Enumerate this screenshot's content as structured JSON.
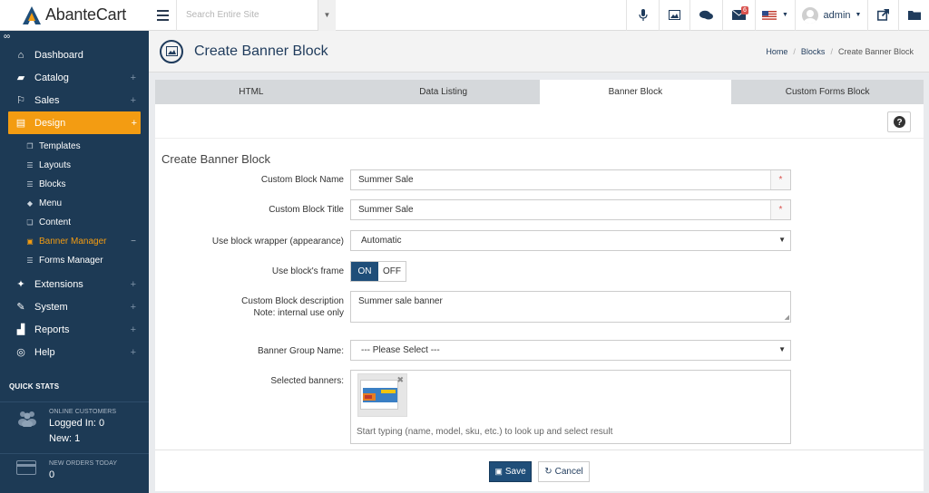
{
  "app": {
    "name": "AbanteCart"
  },
  "search": {
    "placeholder": "Search Entire Site"
  },
  "topbar": {
    "messages_badge": "6",
    "user": "admin"
  },
  "sidebar": {
    "items": [
      {
        "label": "Dashboard",
        "icon": "home-icon",
        "expandable": false
      },
      {
        "label": "Catalog",
        "icon": "folder-open-icon",
        "expandable": true
      },
      {
        "label": "Sales",
        "icon": "flag-icon",
        "expandable": true
      },
      {
        "label": "Design",
        "icon": "file-icon",
        "expandable": true,
        "active": true
      }
    ],
    "design_children": [
      {
        "label": "Templates",
        "icon": "templates-icon"
      },
      {
        "label": "Layouts",
        "icon": "list-icon"
      },
      {
        "label": "Blocks",
        "icon": "list-icon"
      },
      {
        "label": "Menu",
        "icon": "tag-icon"
      },
      {
        "label": "Content",
        "icon": "copy-icon"
      },
      {
        "label": "Banner Manager",
        "icon": "image-icon",
        "current": true
      },
      {
        "label": "Forms Manager",
        "icon": "list-icon"
      }
    ],
    "items_after": [
      {
        "label": "Extensions",
        "icon": "puzzle-icon"
      },
      {
        "label": "System",
        "icon": "wrench-icon"
      },
      {
        "label": "Reports",
        "icon": "bar-chart-icon"
      },
      {
        "label": "Help",
        "icon": "life-ring-icon"
      }
    ],
    "quick_stats": {
      "title": "QUICK STATS",
      "online_label": "ONLINE CUSTOMERS",
      "logged_in": "Logged In: 0",
      "new": "New: 1",
      "orders_label": "NEW ORDERS TODAY",
      "orders_value": "0"
    }
  },
  "header": {
    "title": "Create Banner Block",
    "breadcrumb": [
      "Home",
      "Blocks",
      "Create Banner Block"
    ]
  },
  "tabs": [
    "HTML",
    "Data Listing",
    "Banner Block",
    "Custom Forms Block"
  ],
  "active_tab_index": 2,
  "form": {
    "title": "Create Banner Block",
    "name_label": "Custom Block Name",
    "name_value": "Summer Sale",
    "title_label": "Custom Block Title",
    "title_value": "Summer Sale",
    "wrapper_label": "Use block wrapper (appearance)",
    "wrapper_value": "Automatic",
    "frame_label": "Use block's frame",
    "frame_on": "ON",
    "frame_off": "OFF",
    "desc_label_1": "Custom Block description",
    "desc_label_2": "Note: internal use only",
    "desc_value": "Summer sale banner",
    "group_label": "Banner Group Name:",
    "group_value": "--- Please Select ---",
    "selected_label": "Selected banners:",
    "selected_placeholder": "Start typing (name, model, sku, etc.) to look up and select result",
    "required_mark": "*"
  },
  "buttons": {
    "save": "Save",
    "cancel": "Cancel"
  },
  "colors": {
    "sidebar_bg": "#1d3a55",
    "accent": "#f39c12",
    "primary": "#1f4e79"
  }
}
